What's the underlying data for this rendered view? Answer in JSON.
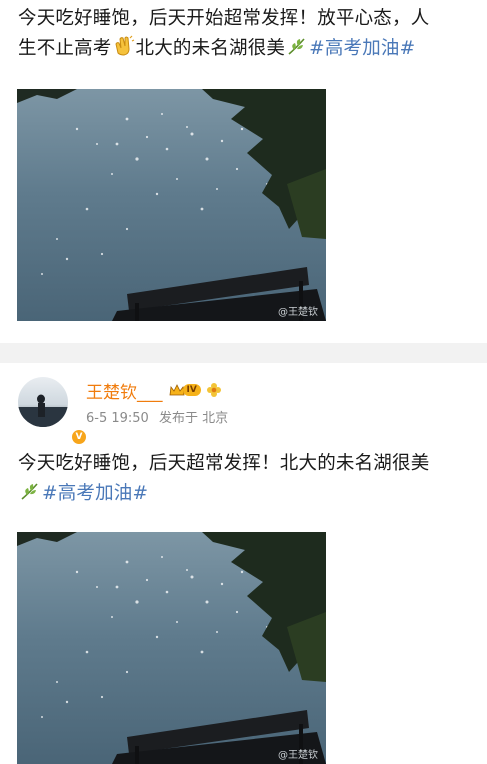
{
  "post1": {
    "text_line1": "今天吃好睡饱，后天开始超常发挥！放平心态，人",
    "text_line2a": "生不止高考",
    "text_line2b": "北大的未名湖很美",
    "topic": "#高考加油#",
    "watermark": "@王楚钦"
  },
  "post2": {
    "username": "王楚钦___",
    "vip_level": "IV",
    "date": "6-5 19:50",
    "source": "发布于 北京",
    "text_line1": "今天吃好睡饱，后天超常发挥！北大的未名湖很美",
    "topic": "#高考加油#",
    "watermark": "@王楚钦"
  },
  "icons": {
    "clap": "clapping-hands-emoji",
    "herb": "herb-leaf-emoji",
    "crown": "crown-icon",
    "flower": "flower-badge-icon"
  },
  "colors": {
    "username": "#f07c0d",
    "topic": "#4a78b8",
    "divider": "#f2f2f2"
  }
}
